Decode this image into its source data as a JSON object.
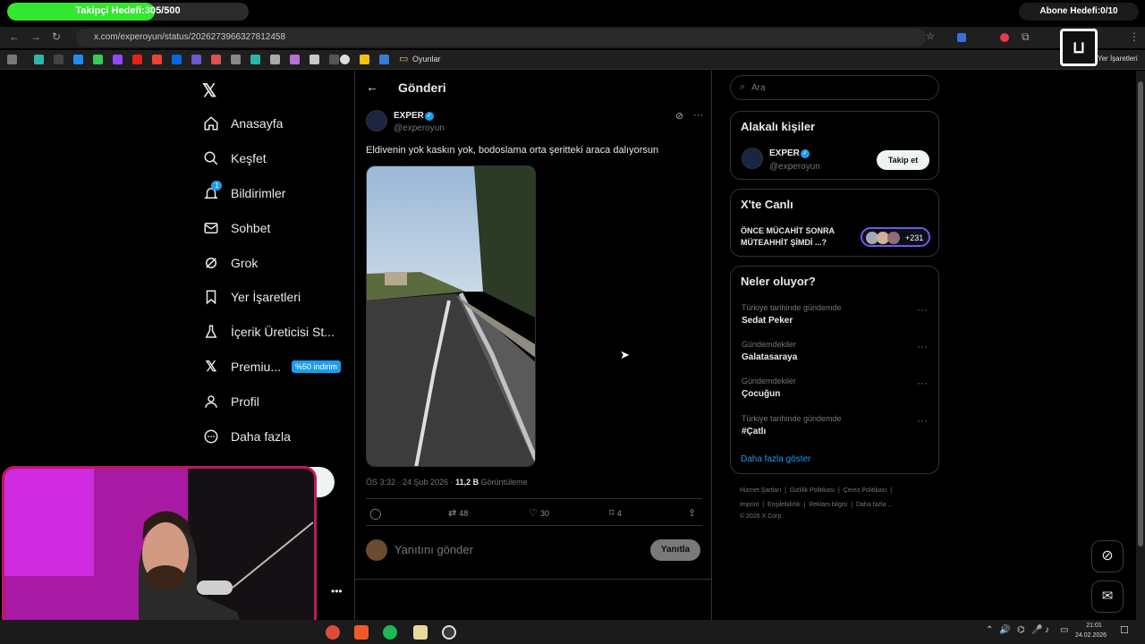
{
  "overlay": {
    "follower_goal": "Takipçi Hedefi:305/500",
    "follower_progress": 0.61,
    "subscriber_goal": "Abone Hedefi:0/10"
  },
  "browser": {
    "url": "x.com/experoyun/status/2026273966327812458",
    "bookmarks_folder": "Oyunlar",
    "bookmarks_right": "Yer İşaretleri"
  },
  "sidebar": {
    "items": [
      {
        "label": "Anasayfa",
        "icon": "home-icon"
      },
      {
        "label": "Keşfet",
        "icon": "search-icon"
      },
      {
        "label": "Bildirimler",
        "icon": "bell-icon",
        "badge": "1"
      },
      {
        "label": "Sohbet",
        "icon": "mail-icon"
      },
      {
        "label": "Grok",
        "icon": "grok-icon"
      },
      {
        "label": "Yer İşaretleri",
        "icon": "bookmark-icon"
      },
      {
        "label": "İçerik Üreticisi St...",
        "icon": "flask-icon"
      },
      {
        "label": "Premiu...",
        "icon": "x-icon",
        "badge": "%50 indirim"
      },
      {
        "label": "Profil",
        "icon": "person-icon"
      },
      {
        "label": "Daha fazla",
        "icon": "more-circle-icon"
      }
    ]
  },
  "post": {
    "header_title": "Gönderi",
    "author_name": "EXPER",
    "author_handle": "@experoyun",
    "text": "Eldivenin yok kaskın yok, bodoslama orta şeritteki araca dalıyorsun",
    "time": "ÖS 3:32 · 24 Şub 2026 · ",
    "views_count": "11,2 B",
    "views_label": " Görüntüleme",
    "retweets": "48",
    "likes": "30",
    "bookmarks": "4",
    "reply_placeholder": "Yanıtını gönder",
    "reply_button": "Yanıtla"
  },
  "right": {
    "search_placeholder": "Ara",
    "related_title": "Alakalı kişiler",
    "related_name": "EXPER",
    "related_handle": "@experoyun",
    "follow_button": "Takip et",
    "live_title": "X'te Canlı",
    "live_text_1": "ÖNCE MÜCAHİT SONRA",
    "live_text_2": "MÜTEAHHİT ŞİMDİ ...?",
    "live_count": "+231",
    "trends_title": "Neler oluyor?",
    "trends": [
      {
        "cat": "Türkiye tarihinde gündemde",
        "name": "Sedat Peker"
      },
      {
        "cat": "Gündemdekiler",
        "name": "Galatasaraya"
      },
      {
        "cat": "Gündemdekiler",
        "name": "Çocuğun"
      },
      {
        "cat": "Türkiye tarihinde gündemde",
        "name": "#Çatlı"
      }
    ],
    "show_more": "Daha fazla göster",
    "footer_line1": [
      "Hizmet Şartları",
      "Gizlilik Politikası",
      "Çerez Politikası"
    ],
    "footer_line2": [
      "Imprint",
      "Erişilebilirlik",
      "Reklam bilgisi",
      "Daha fazla ..."
    ],
    "copyright": "© 2026 X Corp."
  },
  "taskbar": {
    "time": "21:01",
    "date": "24.02.2026"
  },
  "colors": {
    "accent": "#1d9bf0",
    "goal_green": "#33e62f",
    "webcam_border": "#c2185b"
  }
}
